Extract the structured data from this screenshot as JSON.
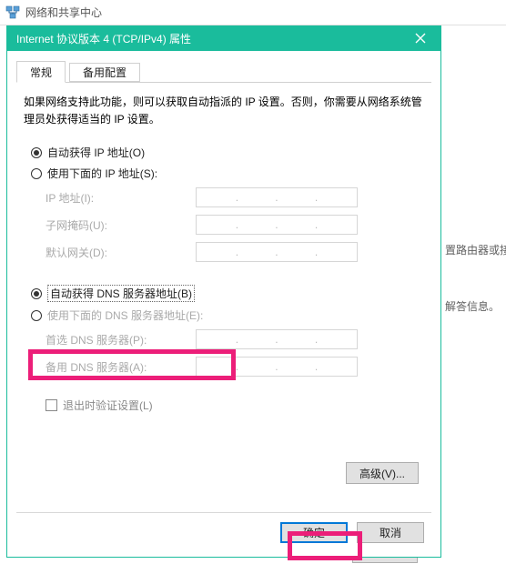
{
  "parent_window": {
    "title": "网络和共享中心"
  },
  "background": {
    "text_router_hint": "置路由器或接",
    "text_diag_hint": "解答信息。"
  },
  "dialog": {
    "title": "Internet 协议版本 4 (TCP/IPv4) 属性",
    "tabs": {
      "general": "常规",
      "alternate": "备用配置"
    },
    "explain_text": "如果网络支持此功能，则可以获取自动指派的 IP 设置。否则，你需要从网络系统管理员处获得适当的 IP 设置。",
    "ip_section": {
      "radio_auto": "自动获得 IP 地址(O)",
      "radio_manual": "使用下面的 IP 地址(S):",
      "fields": {
        "ip": "IP 地址(I):",
        "mask": "子网掩码(U):",
        "gateway": "默认网关(D):"
      }
    },
    "dns_section": {
      "radio_auto": "自动获得 DNS 服务器地址(B)",
      "radio_manual": "使用下面的 DNS 服务器地址(E):",
      "fields": {
        "preferred": "首选 DNS 服务器(P):",
        "alternate": "备用 DNS 服务器(A):"
      }
    },
    "validate_checkbox": "退出时验证设置(L)",
    "advanced_btn": "高级(V)...",
    "ok_btn": "确定",
    "cancel_btn": "取消"
  }
}
